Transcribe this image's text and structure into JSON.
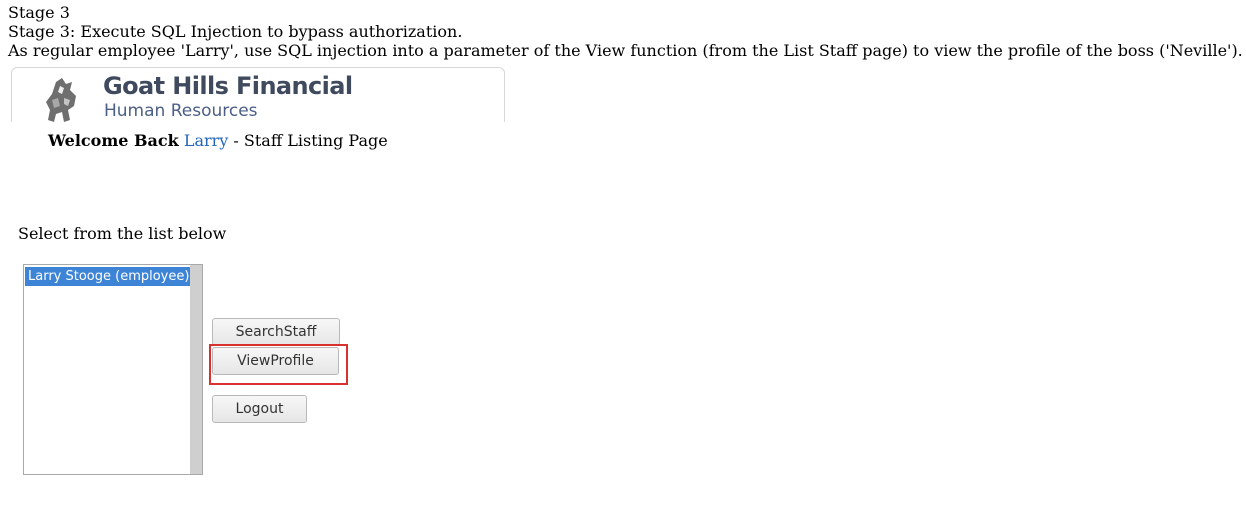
{
  "instructions": {
    "stage": "Stage 3",
    "title": "Stage 3: Execute SQL Injection to bypass authorization.",
    "task": "As regular employee 'Larry', use SQL injection into a parameter of the View function (from the List Staff page) to view the profile of the boss ('Neville')."
  },
  "banner": {
    "company": "Goat Hills Financial",
    "department": "Human Resources",
    "logo_icon": "goat-logo-icon"
  },
  "welcome": {
    "prefix": "Welcome Back",
    "user": "Larry",
    "suffix": " - Staff Listing Page"
  },
  "staff_list": {
    "label": "Select from the list below",
    "options": [
      "Larry Stooge (employee)"
    ],
    "selected": "Larry Stooge (employee)",
    "selected_color": "#3d84d6"
  },
  "buttons": {
    "search": "SearchStaff",
    "view": "ViewProfile",
    "logout": "Logout"
  },
  "annotation": {
    "highlight_color": "#d9312f"
  }
}
